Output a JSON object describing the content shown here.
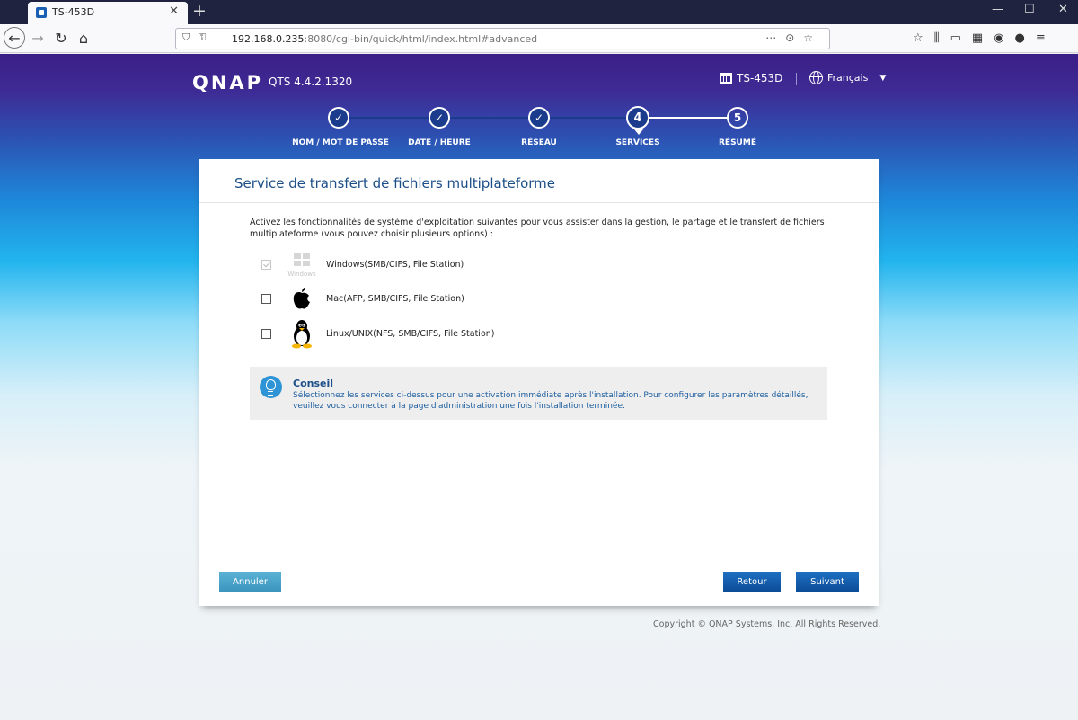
{
  "browser": {
    "tab_title": "TS-453D",
    "tab_close": "✕",
    "new_tab": "+",
    "win_min": "—",
    "win_max": "☐",
    "win_close": "✕",
    "url_host": "192.168.0.235",
    "url_path": ":8080/cgi-bin/quick/html/index.html#advanced"
  },
  "header": {
    "logo": "QNAP",
    "version": "QTS 4.4.2.1320",
    "device": "TS-453D",
    "language": "Français"
  },
  "steps": [
    {
      "label": "NOM / MOT DE PASSE",
      "state": "done",
      "mark": "✓"
    },
    {
      "label": "DATE / HEURE",
      "state": "done",
      "mark": "✓"
    },
    {
      "label": "RÉSEAU",
      "state": "done",
      "mark": "✓"
    },
    {
      "label": "SERVICES",
      "state": "active",
      "mark": "4"
    },
    {
      "label": "RÉSUMÉ",
      "state": "todo",
      "mark": "5"
    }
  ],
  "panel": {
    "title": "Service de transfert de fichiers multiplateforme",
    "intro": "Activez les fonctionnalités de système d'exploitation suivantes pour vous assister dans la gestion, le partage et le transfert de fichiers multiplateforme (vous pouvez choisir plusieurs options) :",
    "options": [
      {
        "label": "Windows(SMB/CIFS, File Station)",
        "checked": true,
        "disabled": true,
        "icon": "windows-logo-icon",
        "icon_caption": "Windows"
      },
      {
        "label": "Mac(AFP, SMB/CIFS, File Station)",
        "checked": false,
        "icon": "apple-logo-icon"
      },
      {
        "label": "Linux/UNIX(NFS, SMB/CIFS, File Station)",
        "checked": false,
        "icon": "tux-penguin-icon"
      }
    ],
    "tip_title": "Conseil",
    "tip_text": "Sélectionnez les services ci-dessus pour une activation immédiate après l'installation. Pour configurer les paramètres détaillés, veuillez vous connecter à la page d'administration une fois l'installation terminée.",
    "cancel_label": "Annuler",
    "back_label": "Retour",
    "next_label": "Suivant"
  },
  "footer": {
    "copyright": "Copyright © QNAP Systems, Inc. All Rights Reserved."
  },
  "colors": {
    "brand_blue": "#1c4f88",
    "step_done": "#1b3b8c",
    "primary_button": "#0b4b96",
    "cancel_button": "#3a93bd"
  }
}
